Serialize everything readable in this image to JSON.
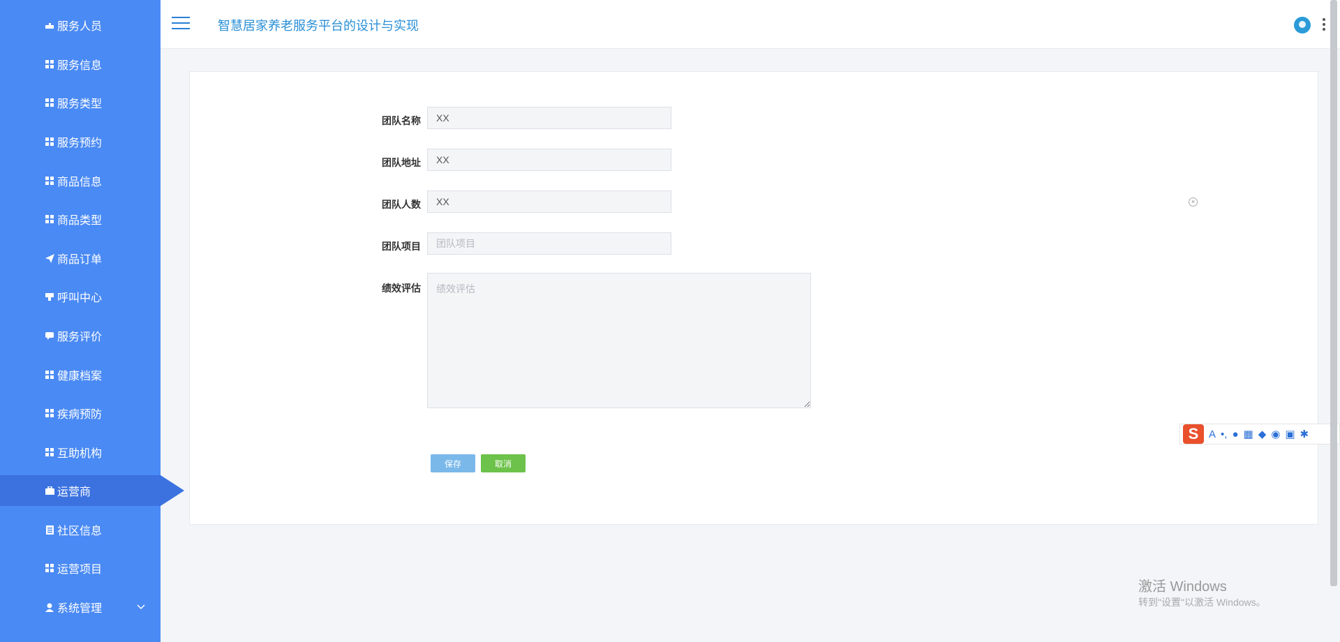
{
  "header": {
    "title": "智慧居家养老服务平台的设计与实现"
  },
  "sidebar": {
    "items": [
      {
        "label": "服务人员",
        "icon": "user-tie-icon"
      },
      {
        "label": "服务信息",
        "icon": "grid-icon"
      },
      {
        "label": "服务类型",
        "icon": "grid-icon"
      },
      {
        "label": "服务预约",
        "icon": "grid-icon"
      },
      {
        "label": "商品信息",
        "icon": "grid-icon"
      },
      {
        "label": "商品类型",
        "icon": "grid-icon"
      },
      {
        "label": "商品订单",
        "icon": "send-icon"
      },
      {
        "label": "呼叫中心",
        "icon": "phone-icon"
      },
      {
        "label": "服务评价",
        "icon": "comment-icon"
      },
      {
        "label": "健康档案",
        "icon": "grid-icon"
      },
      {
        "label": "疾病预防",
        "icon": "grid-icon"
      },
      {
        "label": "互助机构",
        "icon": "grid-icon"
      },
      {
        "label": "运营商",
        "icon": "briefcase-icon",
        "active": true
      },
      {
        "label": "社区信息",
        "icon": "document-icon"
      },
      {
        "label": "运营项目",
        "icon": "grid-icon"
      },
      {
        "label": "系统管理",
        "icon": "user-icon",
        "expandable": true
      }
    ]
  },
  "form": {
    "team_name": {
      "label": "团队名称",
      "value": "XX"
    },
    "team_address": {
      "label": "团队地址",
      "value": "XX"
    },
    "team_size": {
      "label": "团队人数",
      "value": "XX"
    },
    "team_project": {
      "label": "团队项目",
      "value": "",
      "placeholder": "团队项目"
    },
    "performance": {
      "label": "绩效评估",
      "value": "",
      "placeholder": "绩效评估"
    },
    "save_label": "保存",
    "cancel_label": "取消"
  },
  "colors": {
    "sidebar_bg": "#4a8af4",
    "sidebar_active": "#3b72e0",
    "title": "#2a8fd6",
    "save": "#7ab8ea",
    "cancel": "#6cc24a"
  },
  "watermark": {
    "line1": "激活 Windows",
    "line2": "转到\"设置\"以激活 Windows。"
  }
}
